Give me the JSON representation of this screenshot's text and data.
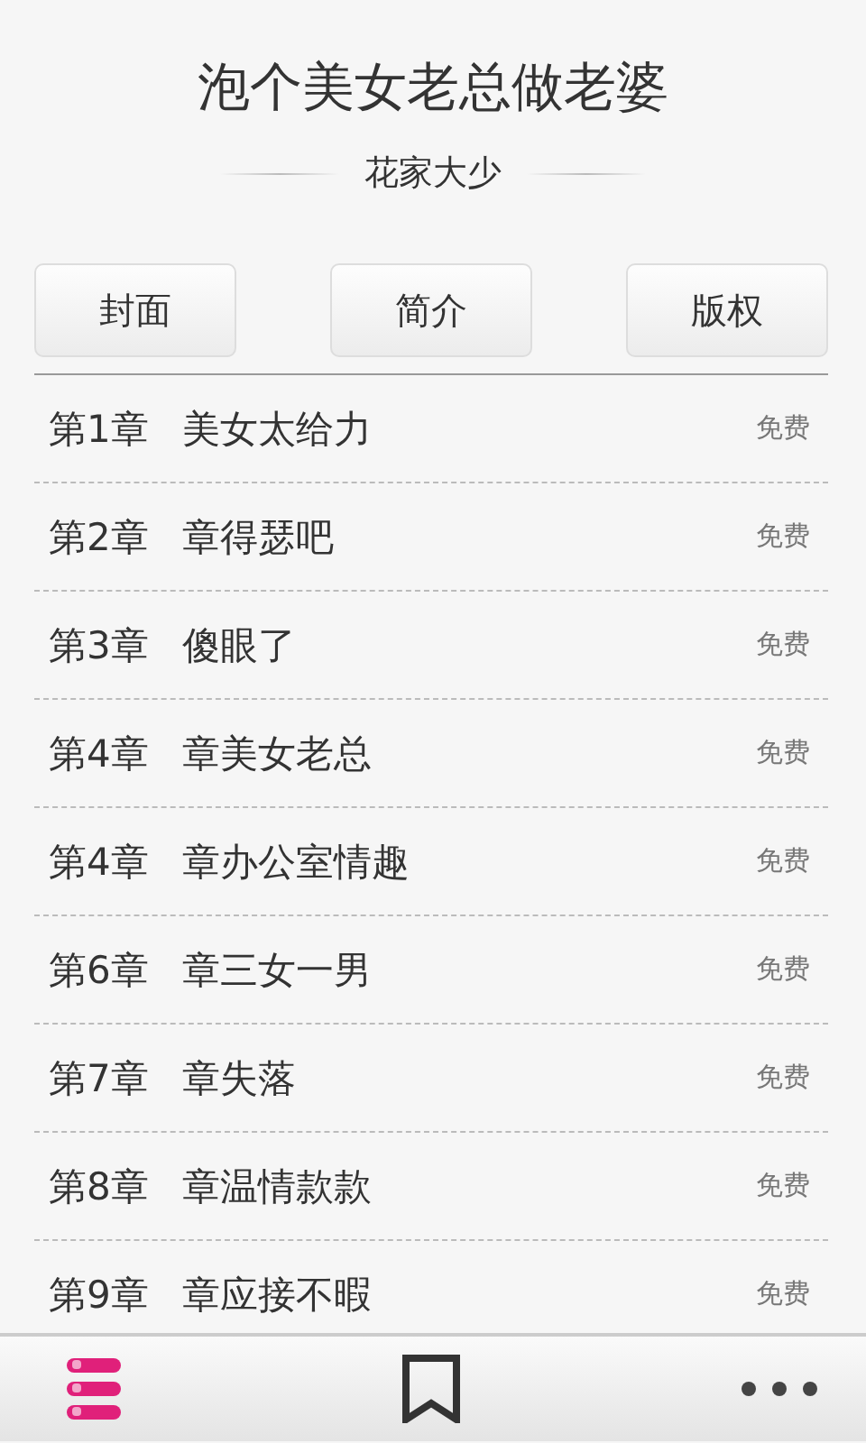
{
  "book": {
    "title": "泡个美女老总做老婆",
    "author": "花家大少"
  },
  "buttons": [
    "封面",
    "简介",
    "版权"
  ],
  "chapters": [
    {
      "number": "第1章",
      "title": "美女太给力",
      "price": "免费"
    },
    {
      "number": "第2章",
      "title": "章得瑟吧",
      "price": "免费"
    },
    {
      "number": "第3章",
      "title": "傻眼了",
      "price": "免费"
    },
    {
      "number": "第4章",
      "title": "章美女老总",
      "price": "免费"
    },
    {
      "number": "第4章",
      "title": "章办公室情趣",
      "price": "免费"
    },
    {
      "number": "第6章",
      "title": "章三女一男",
      "price": "免费"
    },
    {
      "number": "第7章",
      "title": "章失落",
      "price": "免费"
    },
    {
      "number": "第8章",
      "title": "章温情款款",
      "price": "免费"
    },
    {
      "number": "第9章",
      "title": "章应接不暇",
      "price": "免费"
    }
  ]
}
